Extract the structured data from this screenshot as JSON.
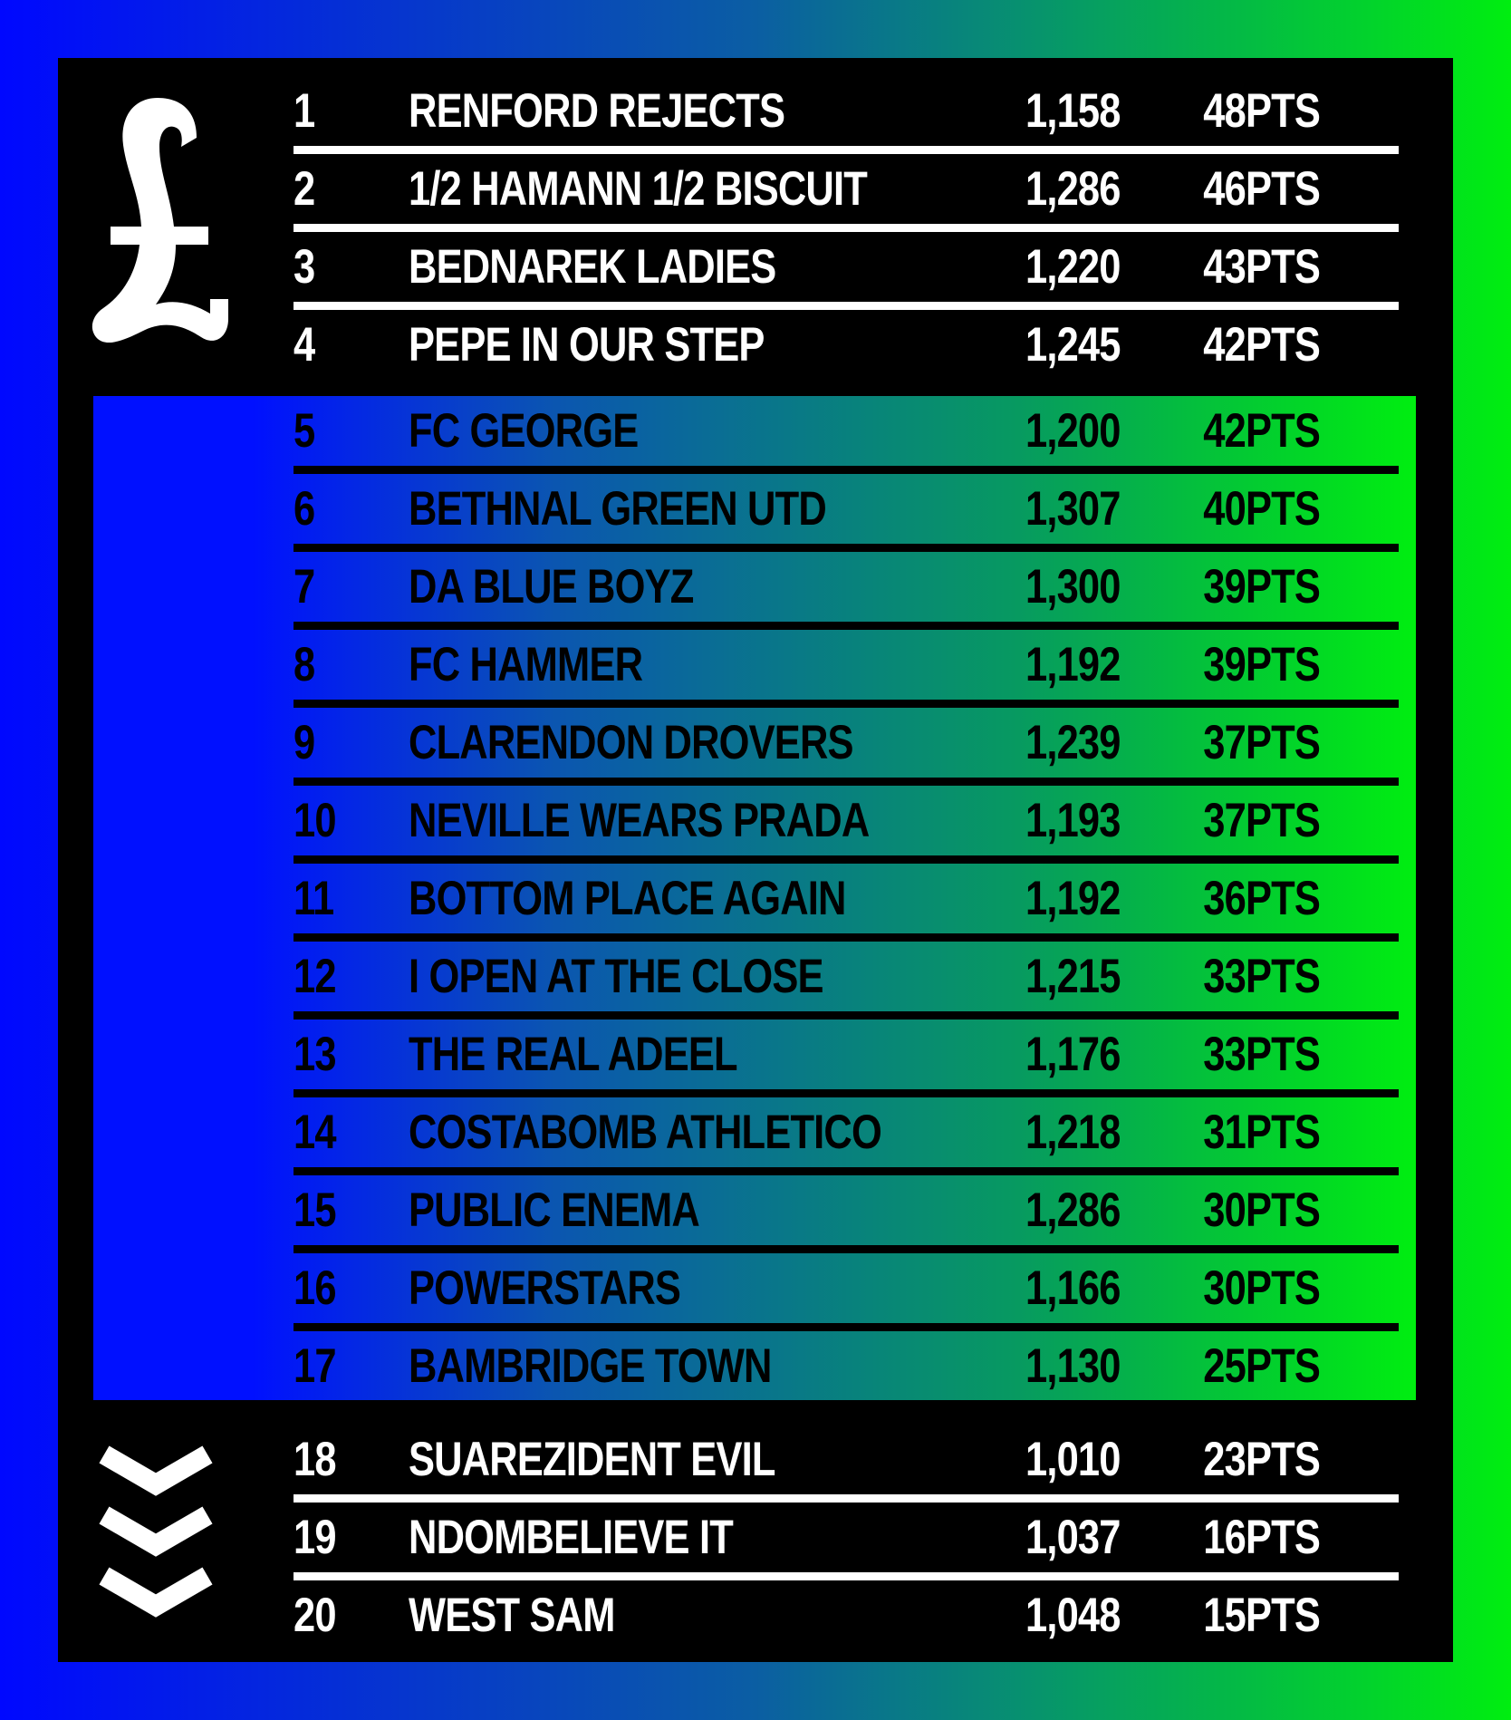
{
  "icons": {
    "top": "pound-sign-icon",
    "bottom": "relegation-chevrons-icon"
  },
  "colors": {
    "frame": "#000000",
    "gradient_start": "#0008ff",
    "gradient_end": "#00ee10",
    "light_text": "#ffffff",
    "dark_text": "#000000"
  },
  "table": {
    "rows": [
      {
        "pos": "1",
        "team": "RENFORD REJECTS",
        "value": "1,158",
        "pts": "48PTS",
        "zone": "top"
      },
      {
        "pos": "2",
        "team": "1/2 HAMANN 1/2 BISCUIT",
        "value": "1,286",
        "pts": "46PTS",
        "zone": "top"
      },
      {
        "pos": "3",
        "team": "BEDNAREK LADIES",
        "value": "1,220",
        "pts": "43PTS",
        "zone": "top"
      },
      {
        "pos": "4",
        "team": "PEPE IN OUR STEP",
        "value": "1,245",
        "pts": "42PTS",
        "zone": "top"
      },
      {
        "pos": "5",
        "team": "FC GEORGE",
        "value": "1,200",
        "pts": "42PTS",
        "zone": "mid"
      },
      {
        "pos": "6",
        "team": "BETHNAL GREEN UTD",
        "value": "1,307",
        "pts": "40PTS",
        "zone": "mid"
      },
      {
        "pos": "7",
        "team": "DA BLUE BOYZ",
        "value": "1,300",
        "pts": "39PTS",
        "zone": "mid"
      },
      {
        "pos": "8",
        "team": "FC HAMMER",
        "value": "1,192",
        "pts": "39PTS",
        "zone": "mid"
      },
      {
        "pos": "9",
        "team": "CLARENDON DROVERS",
        "value": "1,239",
        "pts": "37PTS",
        "zone": "mid"
      },
      {
        "pos": "10",
        "team": "NEVILLE WEARS PRADA",
        "value": "1,193",
        "pts": "37PTS",
        "zone": "mid"
      },
      {
        "pos": "11",
        "team": "BOTTOM PLACE AGAIN",
        "value": "1,192",
        "pts": "36PTS",
        "zone": "mid"
      },
      {
        "pos": "12",
        "team": "I OPEN AT THE CLOSE",
        "value": "1,215",
        "pts": "33PTS",
        "zone": "mid"
      },
      {
        "pos": "13",
        "team": "THE REAL ADEEL",
        "value": "1,176",
        "pts": "33PTS",
        "zone": "mid"
      },
      {
        "pos": "14",
        "team": "COSTABOMB ATHLETICO",
        "value": "1,218",
        "pts": "31PTS",
        "zone": "mid"
      },
      {
        "pos": "15",
        "team": "PUBLIC ENEMA",
        "value": "1,286",
        "pts": "30PTS",
        "zone": "mid"
      },
      {
        "pos": "16",
        "team": "POWERSTARS",
        "value": "1,166",
        "pts": "30PTS",
        "zone": "mid"
      },
      {
        "pos": "17",
        "team": "BAMBRIDGE TOWN",
        "value": "1,130",
        "pts": "25PTS",
        "zone": "mid"
      },
      {
        "pos": "18",
        "team": "SUAREZIDENT EVIL",
        "value": "1,010",
        "pts": "23PTS",
        "zone": "bottom"
      },
      {
        "pos": "19",
        "team": "NDOMBELIEVE IT",
        "value": "1,037",
        "pts": "16PTS",
        "zone": "bottom"
      },
      {
        "pos": "20",
        "team": "WEST SAM",
        "value": "1,048",
        "pts": "15PTS",
        "zone": "bottom"
      }
    ]
  }
}
